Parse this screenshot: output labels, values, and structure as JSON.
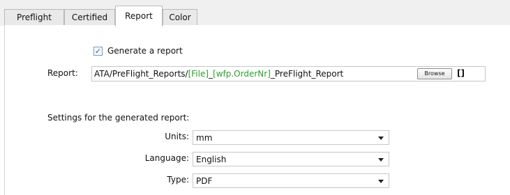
{
  "tabs": [
    {
      "label": "Preflight",
      "active": false
    },
    {
      "label": "Certified",
      "active": false
    },
    {
      "label": "Report",
      "active": true
    },
    {
      "label": "Color",
      "active": false
    }
  ],
  "generate_report": {
    "label": "Generate a report",
    "checked": true
  },
  "report": {
    "label": "Report:",
    "path_parts": {
      "prefix": "ATA/PreFlight_Reports/",
      "file_token": "[File]",
      "sep": "_",
      "order_token": "[wfp.OrderNr]",
      "suffix": "_PreFlight_Report"
    },
    "browse_label": "Browse",
    "brackets_label": "[]"
  },
  "settings": {
    "heading": "Settings for the generated report:",
    "units": {
      "label": "Units:",
      "value": "mm"
    },
    "language": {
      "label": "Language:",
      "value": "English"
    },
    "type": {
      "label": "Type:",
      "value": "PDF"
    }
  },
  "icons": {
    "dropdown": "chevron-down-icon",
    "checkbox": "checkmark-icon"
  }
}
